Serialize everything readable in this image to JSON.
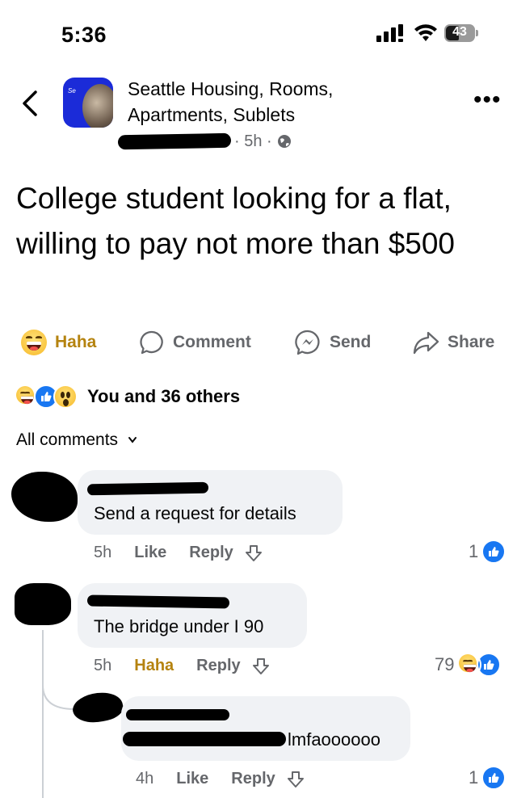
{
  "status_bar": {
    "time": "5:36",
    "battery": "43"
  },
  "post": {
    "group_name": "Seattle Housing, Rooms, Apartments, Sublets",
    "group_avatar_text": "Se",
    "time_label": "· 5h ·",
    "text": "College student looking for a flat, willing to pay not more than $500"
  },
  "actions": [
    {
      "label": "Haha",
      "icon": "haha-emoji-icon"
    },
    {
      "label": "Comment",
      "icon": "comment-icon"
    },
    {
      "label": "Send",
      "icon": "messenger-icon"
    },
    {
      "label": "Share",
      "icon": "share-icon"
    }
  ],
  "reactions": {
    "summary": "You and 36 others",
    "icons": [
      "haha-icon",
      "like-icon",
      "wow-icon"
    ]
  },
  "comments_header": {
    "label": "All comments"
  },
  "comments": [
    {
      "text": "Send a request for details",
      "time": "5h",
      "reaction_action": "Like",
      "reply": "Reply",
      "reaction_count": "1"
    },
    {
      "text": "The bridge under I 90",
      "time": "5h",
      "reaction_action": "Haha",
      "reply": "Reply",
      "reaction_count": "79"
    },
    {
      "text": "lmfaoooooo",
      "time": "4h",
      "reaction_action": "Like",
      "reply": "Reply",
      "reaction_count": "1"
    }
  ],
  "colors": {
    "accent": "#1877f2",
    "haha": "#b5830f",
    "muted": "#65676b",
    "bubble": "#f0f2f5"
  }
}
